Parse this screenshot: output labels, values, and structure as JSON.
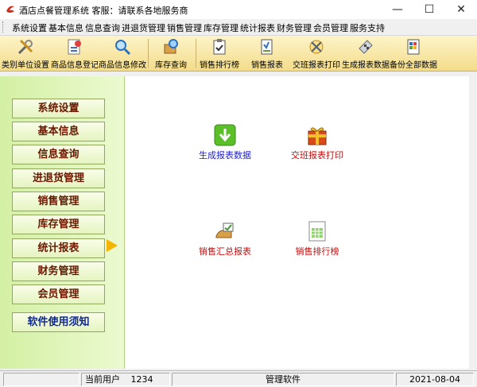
{
  "titlebar": {
    "title": "酒店点餐管理系统 客服：请联系各地服务商",
    "minimize": "—",
    "maximize": "☐",
    "close": "✕"
  },
  "menu": [
    "系统设置",
    "基本信息",
    "信息查询",
    "进退货管理",
    "销售管理",
    "库存管理",
    "统计报表",
    "财务管理",
    "会员管理",
    "服务支持"
  ],
  "toolbar": [
    {
      "label": "类别单位设置",
      "icon": "tools-icon"
    },
    {
      "label": "商品信息登记",
      "icon": "register-icon"
    },
    {
      "label": "商品信息修改",
      "icon": "magnifier-icon"
    },
    {
      "label": "库存查询",
      "icon": "inventory-icon"
    },
    {
      "label": "销售排行榜",
      "icon": "clipboard-icon"
    },
    {
      "label": "销售报表",
      "icon": "report-icon"
    },
    {
      "label": "交班报表打印",
      "icon": "print-icon"
    },
    {
      "label": "生成报表数据",
      "icon": "calculator-icon"
    },
    {
      "label": "备份全部数据",
      "icon": "backup-icon"
    }
  ],
  "sidebar": [
    "系统设置",
    "基本信息",
    "信息查询",
    "进退货管理",
    "销售管理",
    "库存管理",
    "统计报表",
    "财务管理",
    "会员管理"
  ],
  "sidebar_guide": "软件使用须知",
  "modules": [
    {
      "label": "生成报表数据",
      "icon": "download-icon",
      "color": "#1f1fd0"
    },
    {
      "label": "交班报表打印",
      "icon": "gift-icon",
      "color": "#c01010"
    },
    {
      "label": "销售汇总报表",
      "icon": "summary-icon",
      "color": "#c01010"
    },
    {
      "label": "销售排行榜",
      "icon": "spreadsheet-icon",
      "color": "#c01010"
    }
  ],
  "status": {
    "current_user_label": "当前用户",
    "current_user": "1234",
    "app_name": "管理软件",
    "date": "2021-08-04"
  }
}
